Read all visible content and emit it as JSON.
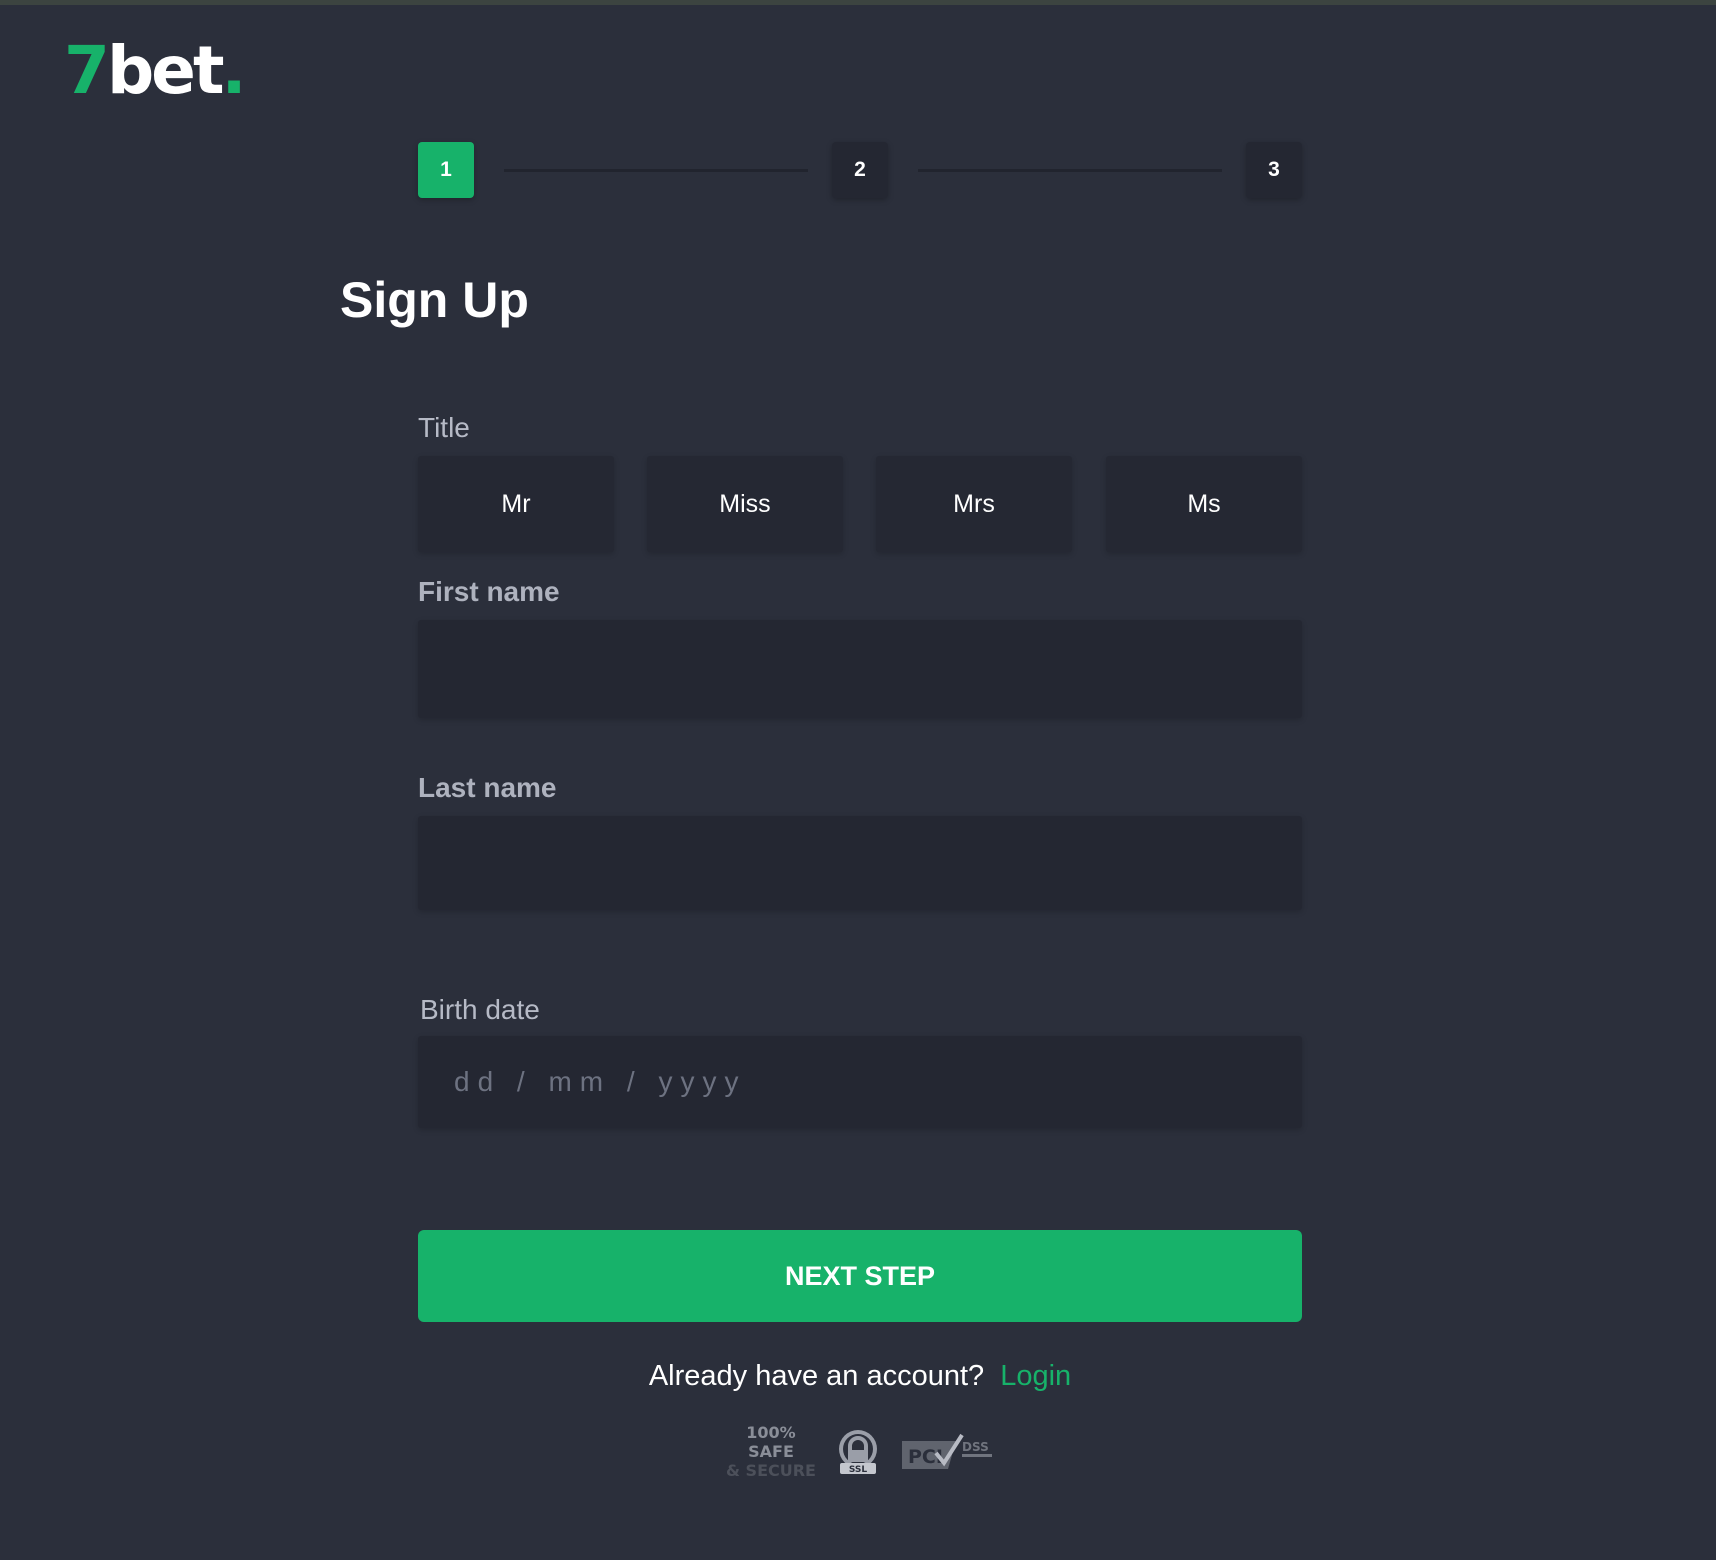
{
  "logo": {
    "seven": "7",
    "bet": "bet",
    "dot": ".",
    "accent": "#17b26a"
  },
  "stepper": {
    "steps": [
      "1",
      "2",
      "3"
    ],
    "active_index": 0
  },
  "page_title": "Sign Up",
  "title_field": {
    "label": "Title",
    "options": [
      "Mr",
      "Miss",
      "Mrs",
      "Ms"
    ]
  },
  "first_name": {
    "label": "First name",
    "value": ""
  },
  "last_name": {
    "label": "Last name",
    "value": ""
  },
  "birth_date": {
    "label": "Birth date",
    "placeholder": "dd / mm / yyyy",
    "value": ""
  },
  "next_button": {
    "label": "NEXT STEP",
    "color": "#17b26a"
  },
  "login_prompt": {
    "text": "Already have an account?",
    "link": "Login"
  },
  "trust_badges": {
    "safe_line1": "100% SAFE",
    "safe_line2": "& SECURE",
    "ssl_icon": "ssl-lock-icon",
    "ssl_text": "SSL",
    "pci_icon": "pci-dss-icon",
    "pci_text": "PCI",
    "dss_text": "DSS"
  }
}
